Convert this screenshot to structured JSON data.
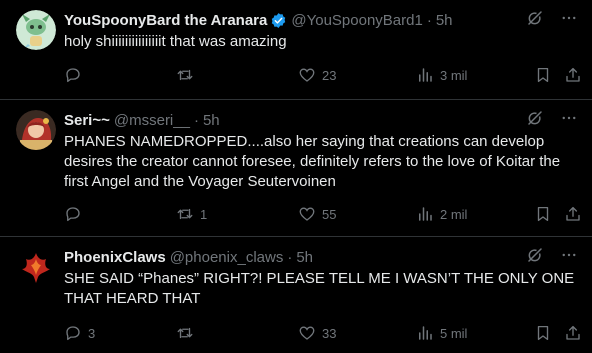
{
  "tweets": [
    {
      "name": "YouSpoonyBard the Aranara",
      "handle": "@YouSpoonyBard1",
      "separator": "·",
      "time": "5h",
      "verified": true,
      "text": "holy shiiiiiiiiiiiiiiit that was amazing",
      "replies": "",
      "retweets": "",
      "likes": "23",
      "views": "3 mil"
    },
    {
      "name": "Seri~~",
      "handle": "@msseri__",
      "separator": "·",
      "time": "5h",
      "verified": false,
      "text": "PHANES NAMEDROPPED....also her saying that creations can develop desires the creator cannot foresee, definitely refers to the love of Koitar the first Angel and the Voyager Seutervoinen",
      "replies": "",
      "retweets": "1",
      "likes": "55",
      "views": "2 mil"
    },
    {
      "name": "PhoenixClaws",
      "handle": "@phoenix_claws",
      "separator": "·",
      "time": "5h",
      "verified": false,
      "text": "SHE SAID “Phanes” RIGHT?! PLEASE TELL ME I WASN’T THE ONLY ONE THAT HEARD THAT",
      "replies": "3",
      "retweets": "",
      "likes": "33",
      "views": "5 mil"
    }
  ],
  "colors": {
    "background": "#000000",
    "text": "#e7e9ea",
    "muted": "#71767b",
    "divider": "#2f3336",
    "verified": "#1d9bf0"
  },
  "icons": [
    "grok-icon",
    "more-icon",
    "reply-icon",
    "retweet-icon",
    "like-icon",
    "views-icon",
    "bookmark-icon",
    "share-icon",
    "verified-icon"
  ]
}
